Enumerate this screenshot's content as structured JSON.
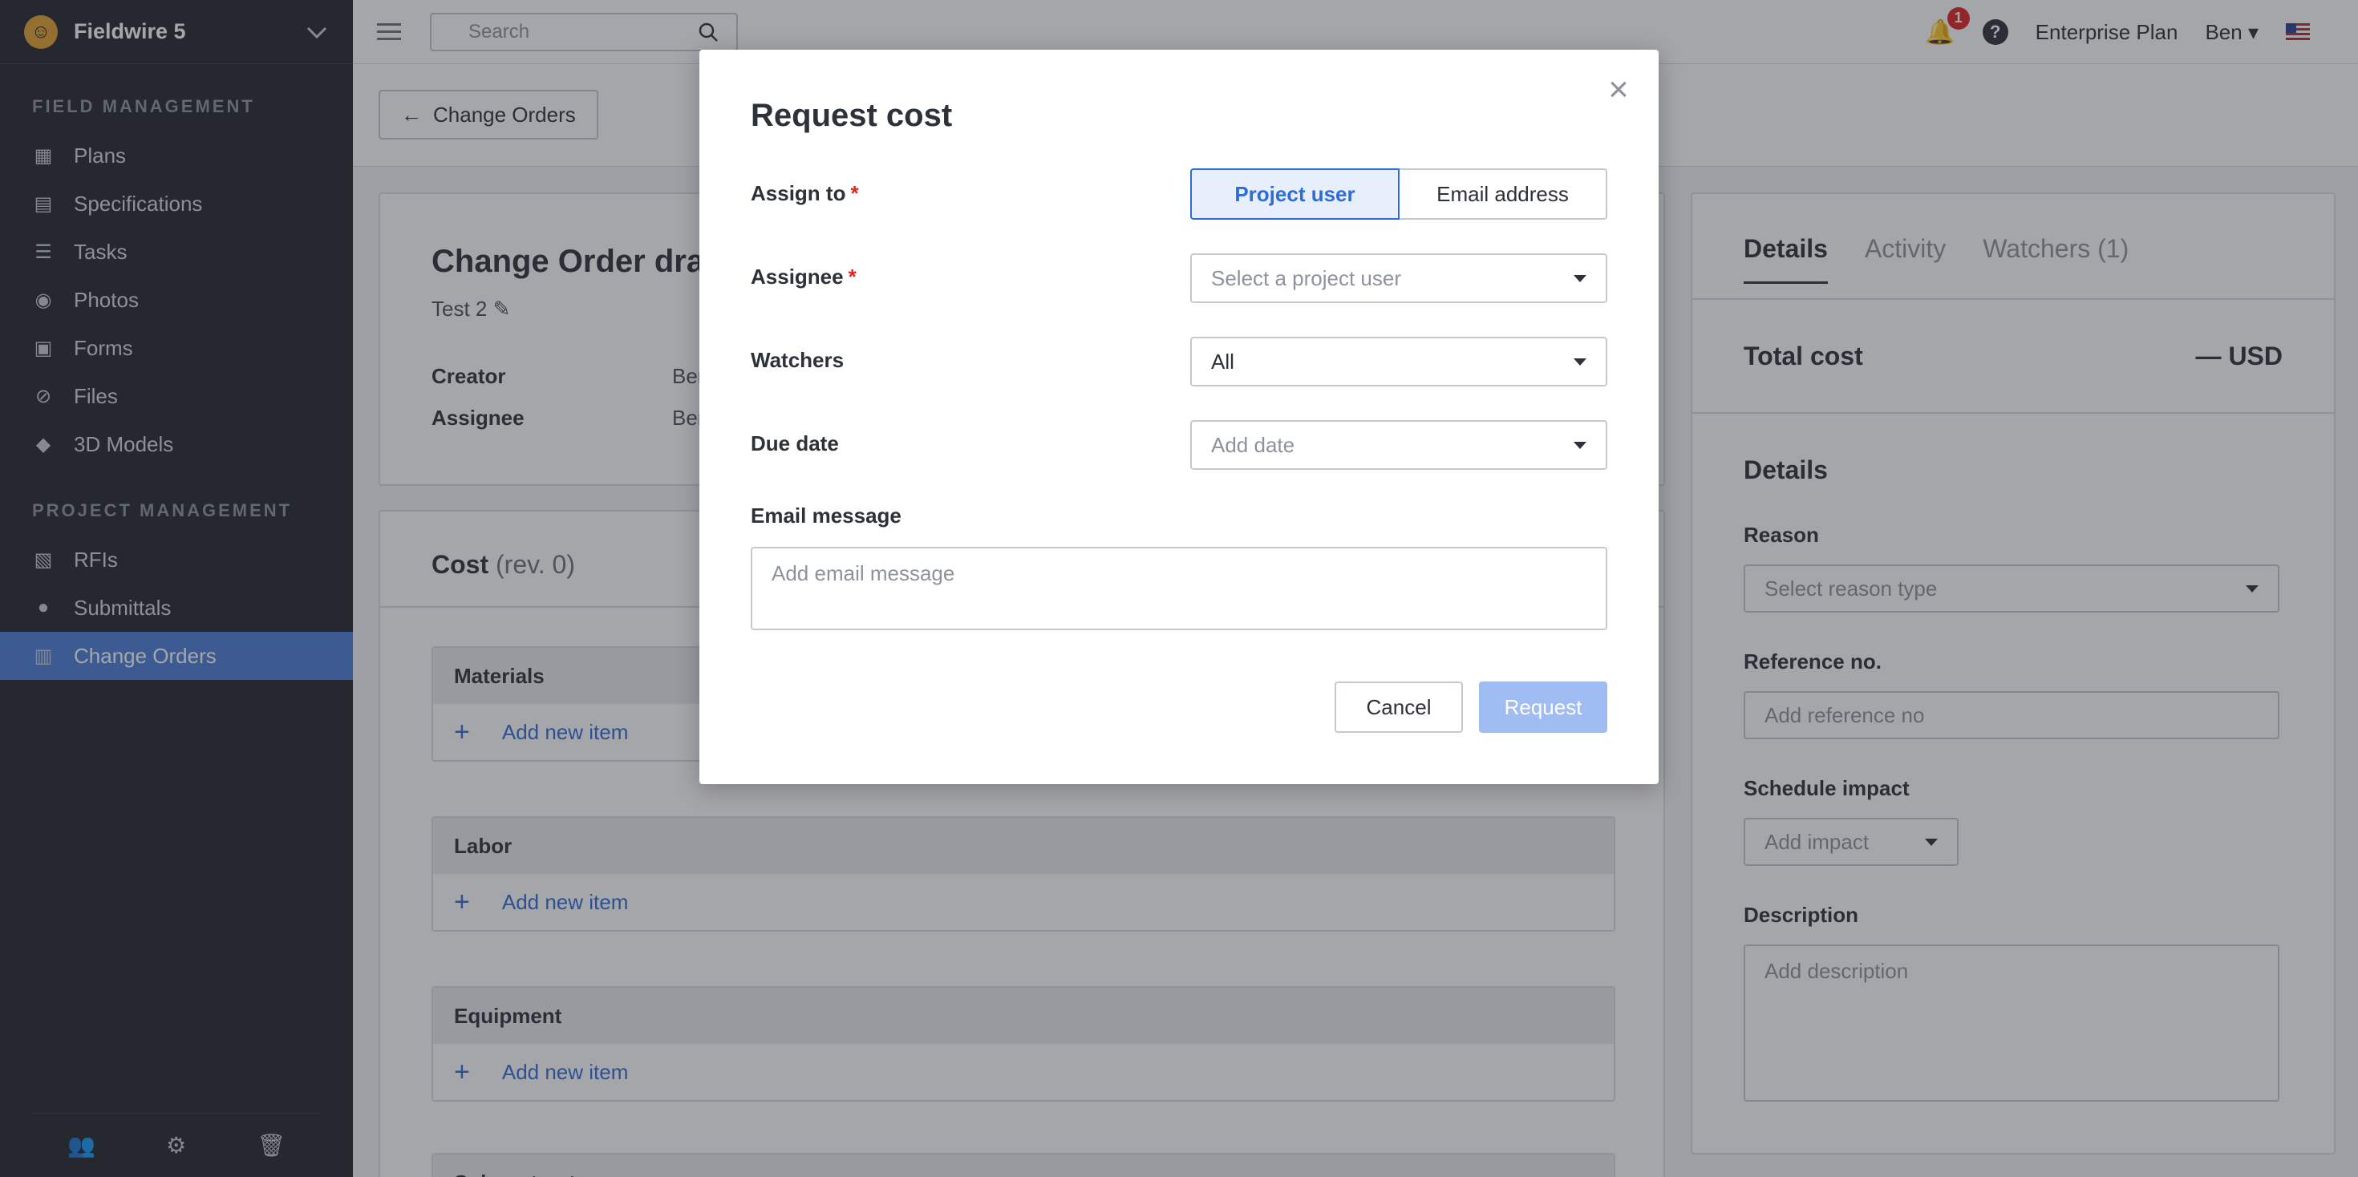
{
  "sidebar": {
    "project_name": "Fieldwire 5",
    "sections": [
      {
        "title": "FIELD MANAGEMENT",
        "items": [
          {
            "label": "Plans",
            "icon": "plans-icon"
          },
          {
            "label": "Specifications",
            "icon": "specifications-icon"
          },
          {
            "label": "Tasks",
            "icon": "tasks-icon"
          },
          {
            "label": "Photos",
            "icon": "camera-icon"
          },
          {
            "label": "Forms",
            "icon": "clipboard-icon"
          },
          {
            "label": "Files",
            "icon": "paperclip-icon"
          },
          {
            "label": "3D Models",
            "icon": "cube-icon"
          }
        ]
      },
      {
        "title": "PROJECT MANAGEMENT",
        "items": [
          {
            "label": "RFIs",
            "icon": "rfi-icon"
          },
          {
            "label": "Submittals",
            "icon": "submittal-icon"
          },
          {
            "label": "Change Orders",
            "icon": "change-orders-icon",
            "active": true
          }
        ]
      }
    ]
  },
  "topbar": {
    "search_placeholder": "Search",
    "notification_count": "1",
    "help_symbol": "?",
    "plan": "Enterprise Plan",
    "user": "Ben"
  },
  "subheader": {
    "back_label": "Change Orders"
  },
  "change_order": {
    "title": "Change Order draf",
    "subtitle": "Test 2",
    "creator_label": "Creator",
    "creator_value": "Ben",
    "assignee_label": "Assignee",
    "assignee_value": "Ben"
  },
  "cost": {
    "title": "Cost",
    "rev": "(rev. 0)",
    "groups": [
      {
        "name": "Materials",
        "add_label": "Add new item"
      },
      {
        "name": "Labor",
        "add_label": "Add new item"
      },
      {
        "name": "Equipment",
        "add_label": "Add new item"
      },
      {
        "name": "Subcontractor",
        "add_label": ""
      }
    ]
  },
  "right_panel": {
    "tabs": [
      "Details",
      "Activity",
      "Watchers (1)"
    ],
    "total_cost_label": "Total cost",
    "total_cost_value": "— USD",
    "details_heading": "Details",
    "reason_label": "Reason",
    "reason_placeholder": "Select reason type",
    "reference_label": "Reference no.",
    "reference_placeholder": "Add reference no",
    "schedule_label": "Schedule impact",
    "schedule_placeholder": "Add impact",
    "description_label": "Description",
    "description_placeholder": "Add description"
  },
  "modal": {
    "title": "Request cost",
    "assign_to_label": "Assign to",
    "required_mark": "*",
    "assign_options": [
      "Project user",
      "Email address"
    ],
    "assignee_label": "Assignee",
    "assignee_placeholder": "Select a project user",
    "watchers_label": "Watchers",
    "watchers_value": "All",
    "due_date_label": "Due date",
    "due_date_placeholder": "Add date",
    "email_message_label": "Email message",
    "email_message_placeholder": "Add email message",
    "cancel_label": "Cancel",
    "request_label": "Request"
  },
  "colors": {
    "accent": "#2f6cd6",
    "sidebar_bg": "#23262c",
    "active_nav": "#4a7fd6",
    "request_disabled": "#9fbdf2",
    "badge": "#e02424"
  }
}
